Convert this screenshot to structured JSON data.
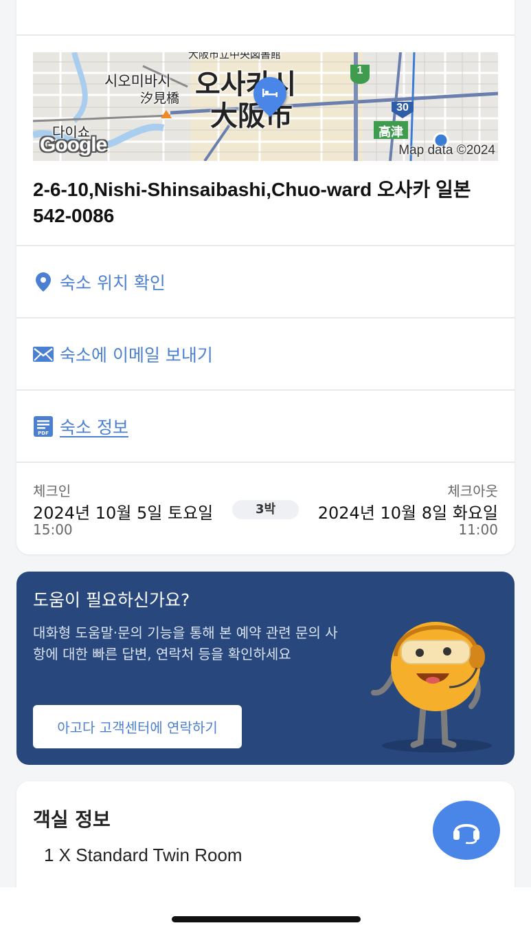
{
  "map": {
    "label_oosaka_hangul": "오사카시",
    "label_oosaka_kanji": "大阪市",
    "label_siomibasi_hangul": "시오미바시",
    "label_siomibasi_kanji": "汐見橋",
    "label_daiso": "다이쇼",
    "label_takatsu": "高津",
    "label_top_kanji": "大阪市立中央図書館",
    "route_1": "1",
    "route_30": "30",
    "google": "Google",
    "attribution": "Map data ©2024"
  },
  "address": "2-6-10,Nishi-Shinsaibashi,Chuo-ward 오사카 일본 542-0086",
  "actions": {
    "location": "숙소 위치 확인",
    "email": "숙소에 이메일 보내기",
    "info": "숙소 정보",
    "pdf_badge": "PDF"
  },
  "stay": {
    "checkin_label": "체크인",
    "checkin_date": "2024년 10월 5일 토요일",
    "checkin_time": "15:00",
    "nights": "3박",
    "checkout_label": "체크아웃",
    "checkout_date": "2024년 10월 8일 화요일",
    "checkout_time": "11:00"
  },
  "help": {
    "title": "도움이 필요하신가요?",
    "body": "대화형 도움말·문의 기능을 통해 본 예약 관련 문의 사항에 대한 빠른 답변, 연락처 등을 확인하세요",
    "button": "아고다 고객센터에 연락하기"
  },
  "room": {
    "title": "객실 정보",
    "item": "1 X Standard Twin Room"
  },
  "colors": {
    "accent": "#4b7fd1",
    "help_bg": "#27477d",
    "fab": "#4a86e8"
  }
}
